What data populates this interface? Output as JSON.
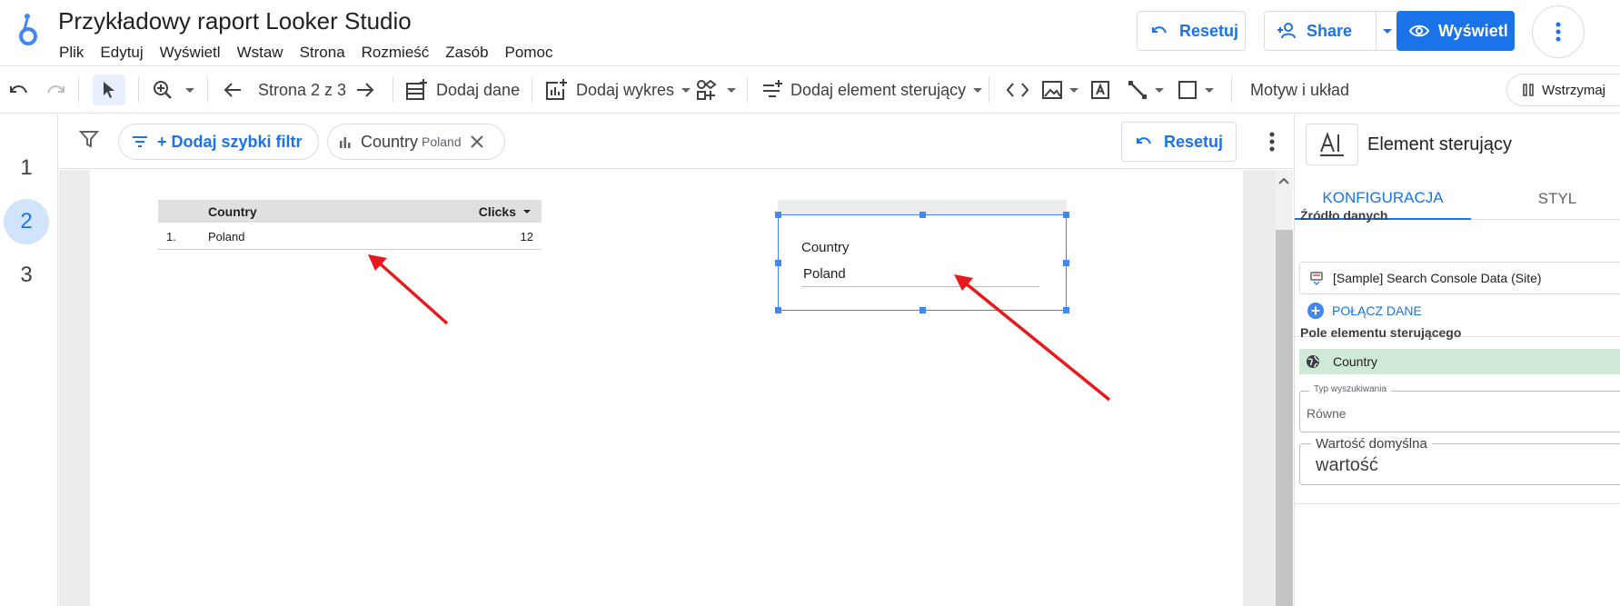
{
  "header": {
    "title": "Przykładowy raport Looker Studio",
    "menu": [
      "Plik",
      "Edytuj",
      "Wyświetl",
      "Wstaw",
      "Strona",
      "Rozmieść",
      "Zasób",
      "Pomoc"
    ],
    "reset_label": "Resetuj",
    "share_label": "Share",
    "view_label": "Wyświetl"
  },
  "toolbar": {
    "page_indicator": "Strona 2 z 3",
    "add_data": "Dodaj dane",
    "add_chart": "Dodaj wykres",
    "add_control": "Dodaj element sterujący",
    "theme_layout": "Motyw i układ",
    "pause": "Wstrzymaj"
  },
  "pages": [
    "1",
    "2",
    "3"
  ],
  "active_page": "2",
  "filter_bar": {
    "add_filter": "+ Dodaj szybki filtr",
    "filter_field": "Country",
    "filter_value": "Poland",
    "reset_label": "Resetuj"
  },
  "table": {
    "headers": {
      "country": "Country",
      "clicks": "Clicks"
    },
    "rows": [
      {
        "num": "1.",
        "country": "Poland",
        "clicks": "12"
      }
    ]
  },
  "control": {
    "label": "Country",
    "value": "Poland"
  },
  "panel": {
    "title": "Element sterujący",
    "tabs": {
      "config": "KONFIGURACJA",
      "style": "STYL"
    },
    "data_source_title": "Źródło danych",
    "data_source": "[Sample] Search Console Data (Site)",
    "connect_data": "POŁĄCZ DANE",
    "control_field_title": "Pole elementu sterującego",
    "control_field": "Country",
    "search_type_label": "Typ wyszukiwania",
    "search_type_value": "Równe",
    "default_value_label": "Wartość domyślna",
    "default_value_value": "wartość"
  },
  "colors": {
    "accent": "#1a73e8",
    "arrow": "#e8191c",
    "field_bg": "#ceead6",
    "selection": "#4285f4"
  }
}
